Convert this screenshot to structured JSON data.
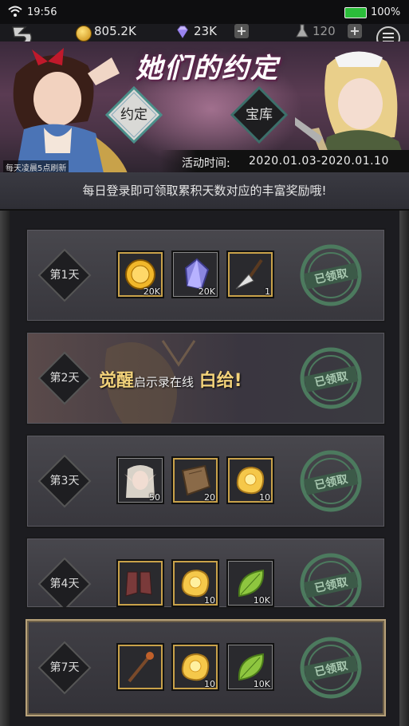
{
  "status_bar": {
    "time": "19:56",
    "battery": "100%"
  },
  "resources": {
    "coins": "805.2K",
    "gems": "23K",
    "stamina": "120"
  },
  "banner": {
    "title": "她们的约定",
    "tab_promise": "约定",
    "tab_treasury": "宝库",
    "refresh_note": "每天凌晨5点刷新",
    "event_time_label": "活动时间:",
    "event_time_value": "2020.01.03-2020.01.10"
  },
  "notice": "每日登录即可领取累积天数对应的丰富奖励哦!",
  "days": [
    {
      "label": "第1天",
      "items": [
        {
          "icon": "gold-coin-icon",
          "qty": "20K"
        },
        {
          "icon": "crystal-icon",
          "qty": "20K"
        },
        {
          "icon": "axe-weapon-icon",
          "qty": "1"
        }
      ],
      "status": "已领取"
    },
    {
      "label": "第2天",
      "promo_a": "觉醒",
      "promo_b": "启示录在线",
      "promo_c": "白给!",
      "status": "已领取"
    },
    {
      "label": "第3天",
      "items": [
        {
          "icon": "elf-hero-portrait-icon",
          "qty": "50"
        },
        {
          "icon": "cloth-scroll-icon",
          "qty": "20"
        },
        {
          "icon": "gold-ore-icon",
          "qty": "10"
        }
      ],
      "status": "已领取"
    },
    {
      "label": "第4天",
      "items": [
        {
          "icon": "boots-icon",
          "qty": ""
        },
        {
          "icon": "gold-ore-icon",
          "qty": "10"
        },
        {
          "icon": "green-leaf-icon",
          "qty": "10K"
        }
      ],
      "status": "已领取"
    },
    {
      "label": "第7天",
      "items": [
        {
          "icon": "staff-icon",
          "qty": ""
        },
        {
          "icon": "gold-ore-icon",
          "qty": "10"
        },
        {
          "icon": "green-leaf-icon",
          "qty": "10K"
        }
      ],
      "status": "已领取"
    }
  ]
}
